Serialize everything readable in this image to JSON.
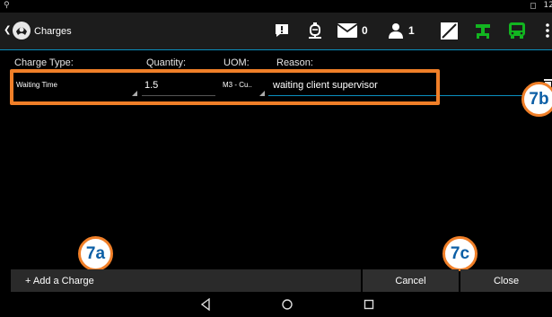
{
  "status_bar": {
    "time": "12"
  },
  "app_bar": {
    "title": "Charges",
    "messages_count": "0",
    "users_count": "1",
    "icons": [
      "back-arrow-icon",
      "app-logo-icon",
      "alert-icon",
      "tank-icon",
      "mail-icon",
      "person-icon",
      "slash-square-icon",
      "network-icon",
      "bus-icon",
      "overflow-menu-icon"
    ],
    "accent_color": "#0a8fbf",
    "green_color": "#12b520"
  },
  "table": {
    "headers": {
      "charge_type": "Charge Type:",
      "quantity": "Quantity:",
      "uom": "UOM:",
      "reason": "Reason:"
    },
    "row": {
      "charge_type": "Waiting Time",
      "quantity": "1.5",
      "uom": "M3 - Cu..",
      "reason": "waiting client supervisor"
    }
  },
  "callouts": {
    "a": "7a",
    "b": "7b",
    "c": "7c"
  },
  "highlight_color": "#f07f28",
  "buttons": {
    "add_charge": "+ Add a Charge",
    "cancel": "Cancel",
    "close": "Close"
  }
}
